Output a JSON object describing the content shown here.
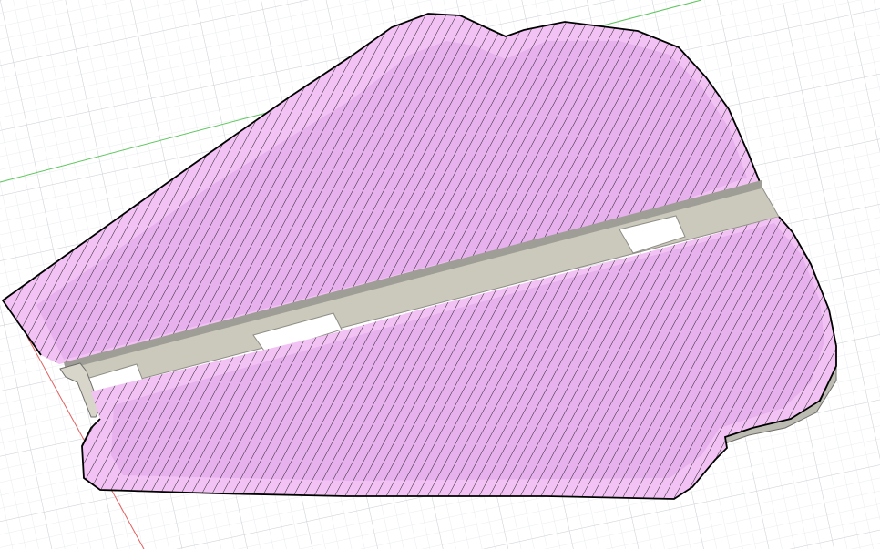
{
  "viewport": {
    "background": "#ffffff",
    "grid_minor_color": "#e4e6ea",
    "grid_major_color": "#cfd2d7",
    "axis_x_color": "#e06060",
    "axis_y_color": "#5fc65f"
  },
  "model": {
    "section_fill": "#f3c2f5",
    "section_inner_fill": "#e7b1ee",
    "hatch_color": "#111111",
    "outline_color": "#000000",
    "channel_fill": "#cbc9bc",
    "channel_edge_color": "#8f8e86",
    "side_face_color": "#bdbcb3"
  }
}
